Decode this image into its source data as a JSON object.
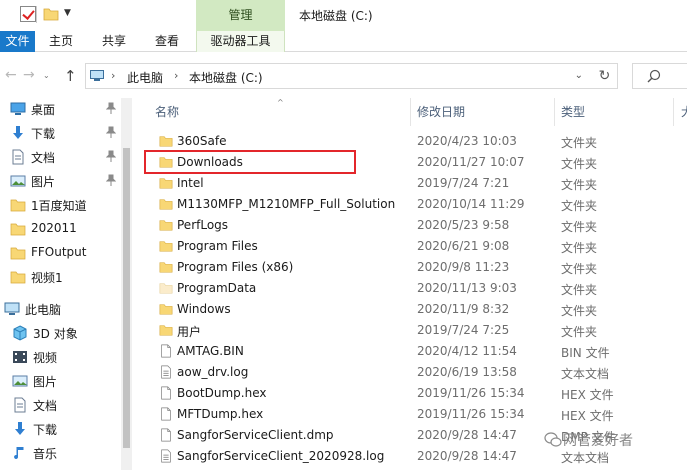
{
  "titlebar": {
    "manage_tab": "管理",
    "window_title": "本地磁盘 (C:)",
    "qa_dropdown": "▼"
  },
  "ribbon": {
    "file": "文件",
    "home": "主页",
    "share": "共享",
    "view": "查看",
    "drive_tools": "驱动器工具"
  },
  "address": {
    "crumbs": [
      "此电脑",
      "本地磁盘 (C:)"
    ],
    "separator": "›",
    "dropdown": "⌄",
    "refresh": "↻"
  },
  "nav": {
    "back": "←",
    "forward": "→",
    "recent": "⌄",
    "up": "↑"
  },
  "sidebar": {
    "items": [
      {
        "label": "桌面",
        "icon": "desktop-icon",
        "pinned": true
      },
      {
        "label": "下载",
        "icon": "download-arrow-icon",
        "pinned": true
      },
      {
        "label": "文档",
        "icon": "document-icon",
        "pinned": true
      },
      {
        "label": "图片",
        "icon": "picture-icon",
        "pinned": true
      },
      {
        "label": "1百度知道",
        "icon": "folder-icon",
        "pinned": false
      },
      {
        "label": "202011",
        "icon": "folder-icon",
        "pinned": false
      },
      {
        "label": "FFOutput",
        "icon": "folder-icon",
        "pinned": false
      },
      {
        "label": "视频1",
        "icon": "folder-icon",
        "pinned": false
      },
      {
        "label": "此电脑",
        "icon": "this-pc-icon",
        "pinned": false
      },
      {
        "label": "3D 对象",
        "icon": "3d-objects-icon",
        "pinned": false
      },
      {
        "label": "视频",
        "icon": "video-icon",
        "pinned": false
      },
      {
        "label": "图片",
        "icon": "picture-icon",
        "pinned": false
      },
      {
        "label": "文档",
        "icon": "document-icon",
        "pinned": false
      },
      {
        "label": "下载",
        "icon": "download-arrow-icon",
        "pinned": false
      },
      {
        "label": "音乐",
        "icon": "music-icon",
        "pinned": false
      }
    ],
    "pin_glyph": "📌"
  },
  "filelist": {
    "headers": {
      "name": "名称",
      "date": "修改日期",
      "type": "类型",
      "size": "大"
    },
    "sort_arrow": "^",
    "rows": [
      {
        "name": "360Safe",
        "date": "2020/4/23 10:03",
        "type": "文件夹",
        "kind": "folder"
      },
      {
        "name": "Downloads",
        "date": "2020/11/27 10:07",
        "type": "文件夹",
        "kind": "folder"
      },
      {
        "name": "Intel",
        "date": "2019/7/24 7:21",
        "type": "文件夹",
        "kind": "folder"
      },
      {
        "name": "M1130MFP_M1210MFP_Full_Solution",
        "date": "2020/10/14 11:29",
        "type": "文件夹",
        "kind": "folder"
      },
      {
        "name": "PerfLogs",
        "date": "2020/5/23 9:58",
        "type": "文件夹",
        "kind": "folder"
      },
      {
        "name": "Program Files",
        "date": "2020/6/21 9:08",
        "type": "文件夹",
        "kind": "folder"
      },
      {
        "name": "Program Files (x86)",
        "date": "2020/9/8 11:23",
        "type": "文件夹",
        "kind": "folder"
      },
      {
        "name": "ProgramData",
        "date": "2020/11/13 9:03",
        "type": "文件夹",
        "kind": "folder-faded"
      },
      {
        "name": "Windows",
        "date": "2020/11/9 8:32",
        "type": "文件夹",
        "kind": "folder"
      },
      {
        "name": "用户",
        "date": "2019/7/24 7:25",
        "type": "文件夹",
        "kind": "folder"
      },
      {
        "name": "AMTAG.BIN",
        "date": "2020/4/12 11:54",
        "type": "BIN 文件",
        "kind": "file"
      },
      {
        "name": "aow_drv.log",
        "date": "2020/6/19 13:58",
        "type": "文本文档",
        "kind": "textfile"
      },
      {
        "name": "BootDump.hex",
        "date": "2019/11/26 15:34",
        "type": "HEX 文件",
        "kind": "file"
      },
      {
        "name": "MFTDump.hex",
        "date": "2019/11/26 15:34",
        "type": "HEX 文件",
        "kind": "file"
      },
      {
        "name": "SangforServiceClient.dmp",
        "date": "2020/9/28 14:47",
        "type": "DMP 文件",
        "kind": "file"
      },
      {
        "name": "SangforServiceClient_2020928.log",
        "date": "2020/9/28 14:47",
        "type": "文本文档",
        "kind": "textfile"
      }
    ]
  },
  "watermark": "网管爱好者",
  "colors": {
    "file_tab": "#1979ca",
    "manage_tab": "#d2e9c2",
    "folder": "#f8d775",
    "highlight_box": "#e3262b",
    "header_text": "#4c607a"
  }
}
